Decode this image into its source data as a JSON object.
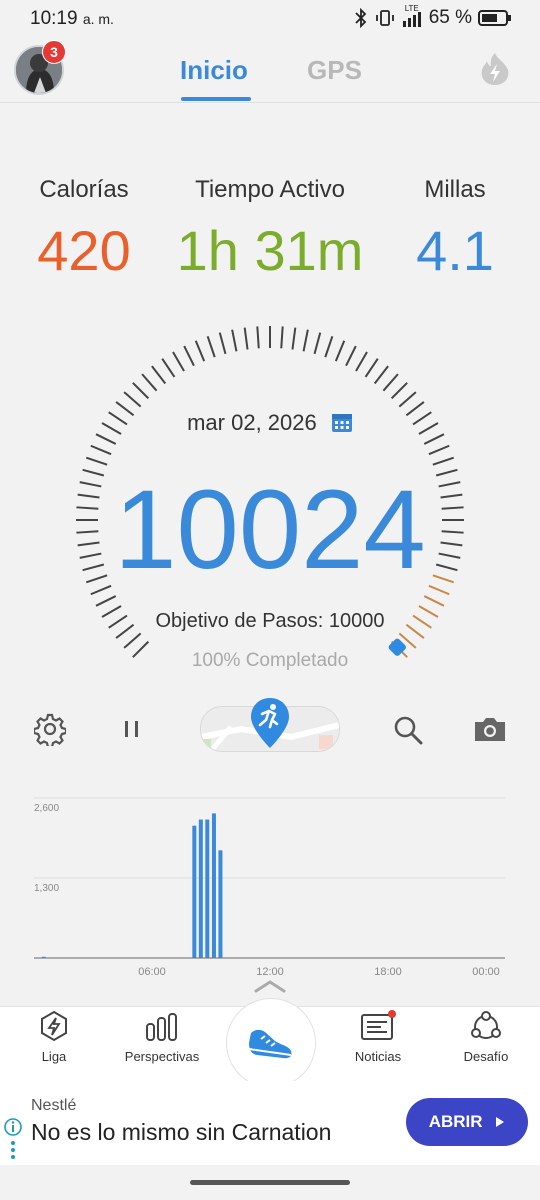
{
  "status_bar": {
    "time": "10:19",
    "ampm": "a. m.",
    "network": "LTE",
    "battery": "65 %"
  },
  "header": {
    "notification_count": "3",
    "tabs": [
      {
        "label": "Inicio",
        "active": true
      },
      {
        "label": "GPS",
        "active": false
      }
    ],
    "accent": "#3b8ad9"
  },
  "stats": [
    {
      "label": "Calorías",
      "value": "420",
      "color": "#e8612c"
    },
    {
      "label": "Tiempo Activo",
      "value": "1h 31m",
      "color": "#7cac2c"
    },
    {
      "label": "Millas",
      "value": "4.1",
      "color": "#3b8ad9"
    }
  ],
  "gauge": {
    "date": "mar 02, 2026",
    "steps": "10024",
    "goal_text": "Objetivo de Pasos: 10000",
    "completed_text": "100% Completado",
    "progress": 1.0
  },
  "chart_data": {
    "type": "bar",
    "yticks": [
      "2,600",
      "1,300"
    ],
    "xticks": [
      "06:00",
      "12:00",
      "18:00",
      "00:00"
    ],
    "ylim": [
      0,
      2600
    ],
    "x": [
      0.5,
      8.17,
      8.5,
      8.83,
      9.17,
      9.5
    ],
    "values": [
      20,
      2150,
      2250,
      2250,
      2350,
      1750
    ],
    "xlim": [
      0,
      24
    ],
    "color": "#3b8ad9"
  },
  "nav": {
    "items": [
      {
        "label": "Liga",
        "icon": "lightning-icon"
      },
      {
        "label": "Perspectivas",
        "icon": "bars-icon"
      },
      {
        "label": "Noticias",
        "icon": "news-icon"
      },
      {
        "label": "Desafío",
        "icon": "network-icon"
      }
    ]
  },
  "ad": {
    "brand": "Nestlé",
    "headline": "No es lo mismo sin Carnation",
    "button": "ABRIR"
  }
}
